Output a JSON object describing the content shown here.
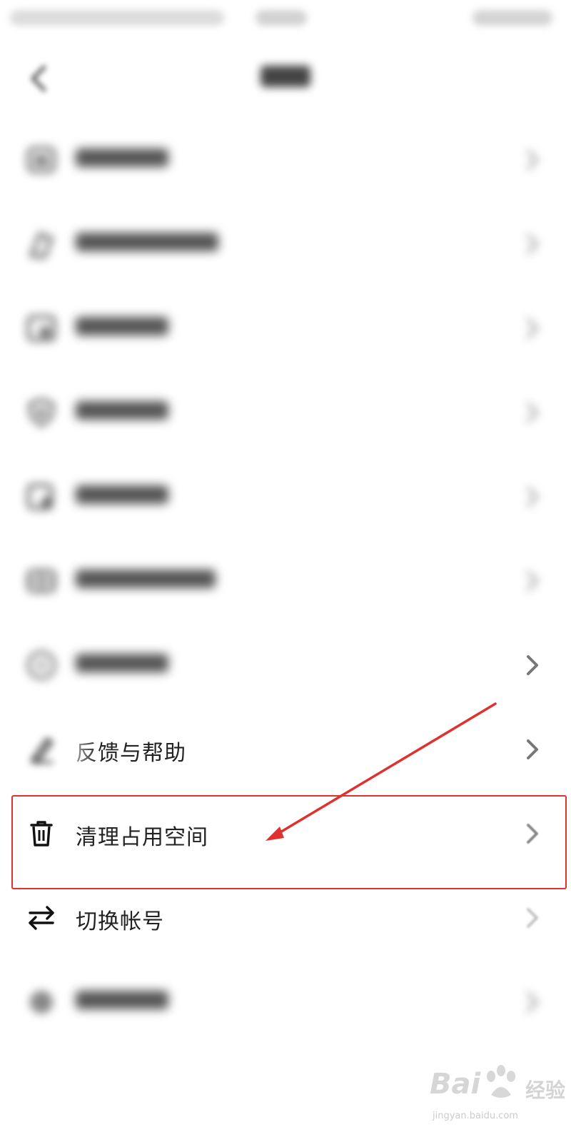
{
  "menu": {
    "items": [
      {
        "label": "",
        "icon": "headset-icon",
        "blurred": true
      },
      {
        "label": "",
        "icon": "shield-icon",
        "blurred": true
      },
      {
        "label": "",
        "icon": "lock-icon",
        "blurred": true
      },
      {
        "label": "",
        "icon": "privacy-icon",
        "blurred": true
      },
      {
        "label": "",
        "icon": "permission-icon",
        "blurred": true
      },
      {
        "label": "",
        "icon": "grid-icon",
        "blurred": true
      },
      {
        "label": "",
        "icon": "info-icon",
        "blurred": true
      },
      {
        "label": "反馈与帮助",
        "icon": "pen-icon",
        "blurred": false
      },
      {
        "label": "清理占用空间",
        "icon": "trash-icon",
        "blurred": false
      },
      {
        "label": "切换帐号",
        "icon": "swap-arrows-icon",
        "blurred": false
      },
      {
        "label": "",
        "icon": "logout-icon",
        "blurred": true
      }
    ]
  },
  "annotation": {
    "highlight_color": "#e03131"
  },
  "watermark": {
    "main": "Bai",
    "suffix": "经验",
    "url": "jingyan.baidu.com"
  }
}
